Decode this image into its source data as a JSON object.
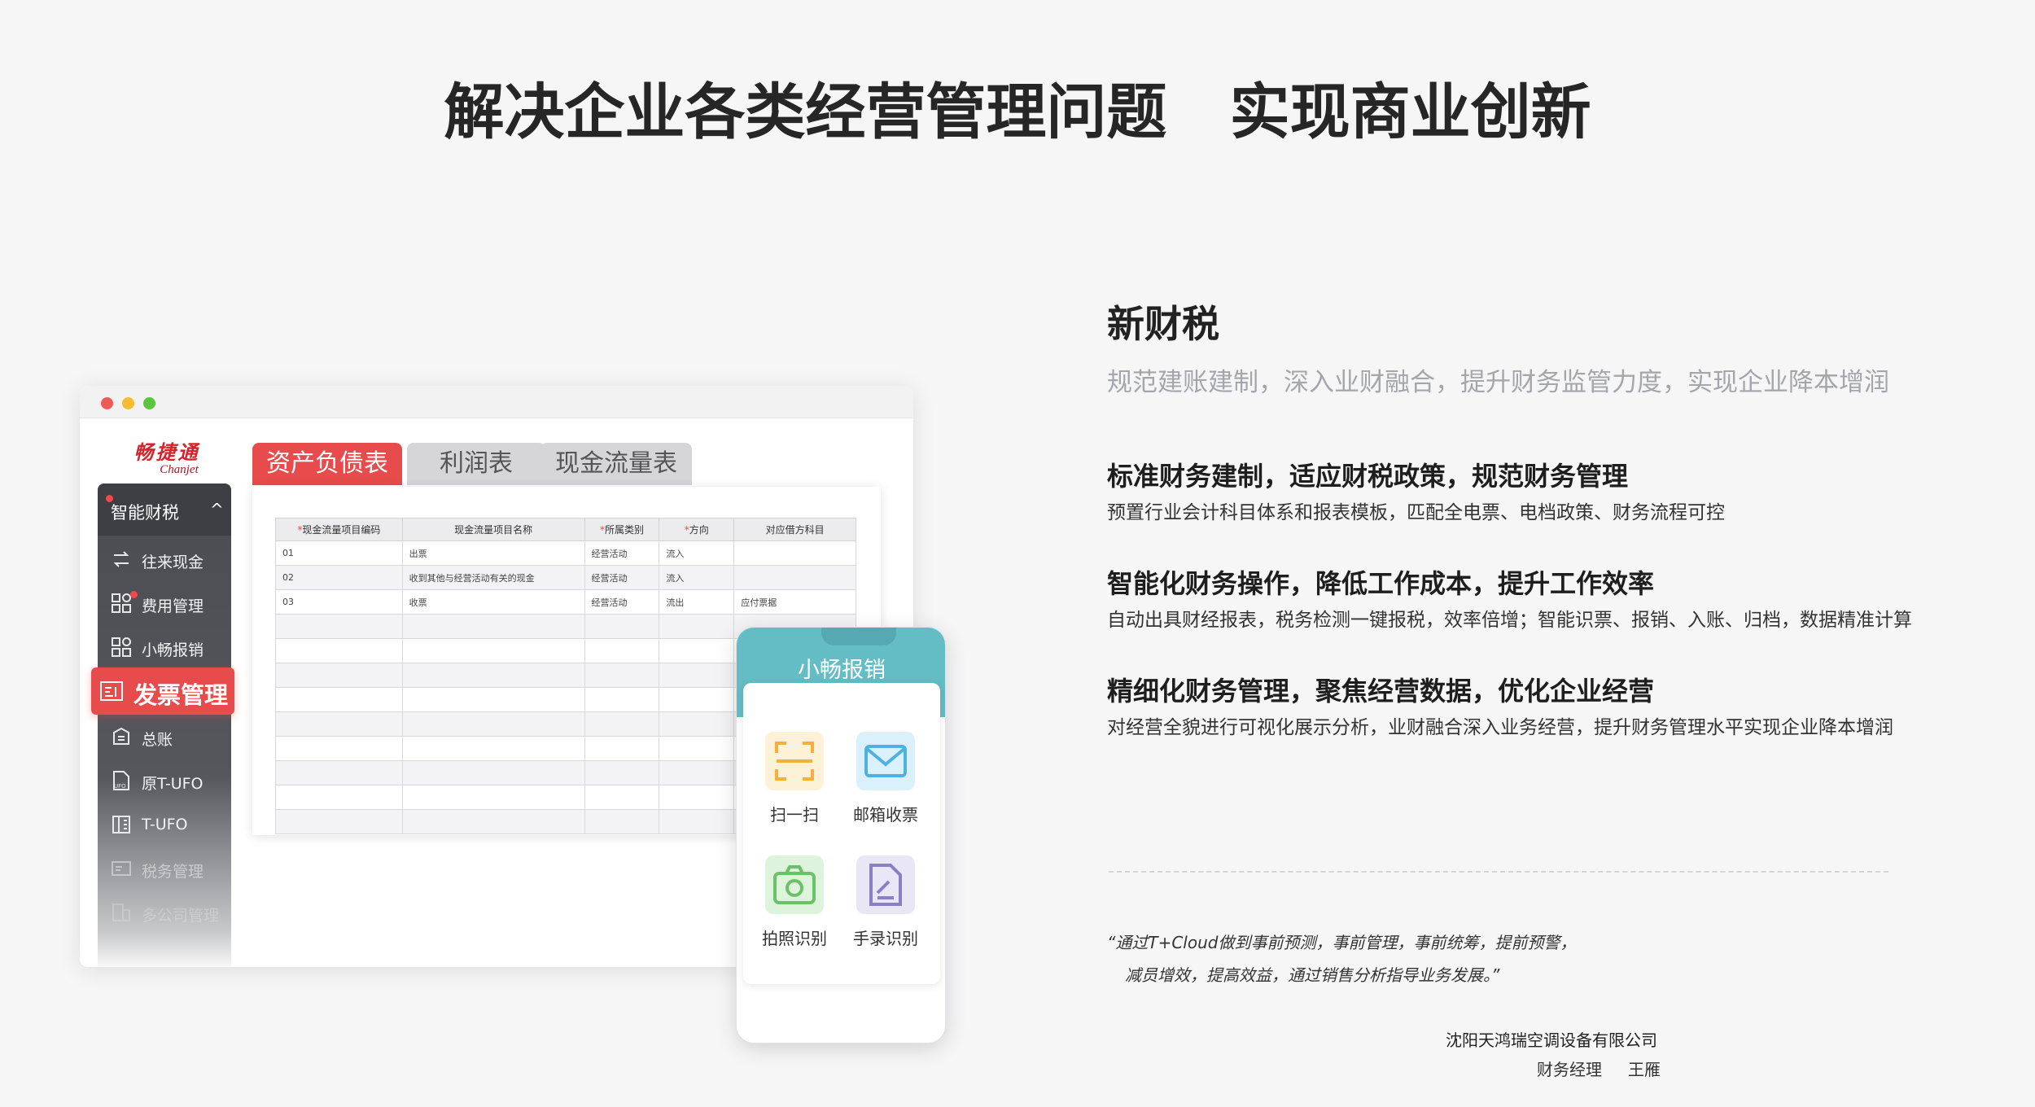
{
  "headline": "解决企业各类经营管理问题   实现商业创新",
  "app": {
    "logo_cn": "畅捷通",
    "logo_en": "Chanjet",
    "sidebar": {
      "section_label": "智能财税",
      "items": [
        {
          "label": "往来现金",
          "icon": "transfer-icon"
        },
        {
          "label": "费用管理",
          "icon": "grid-apps-icon"
        },
        {
          "label": "小畅报销",
          "icon": "grid-apps-icon"
        },
        {
          "label": "发票管理",
          "icon": "invoice-icon",
          "active": true
        },
        {
          "label": "总账",
          "icon": "ledger-icon"
        },
        {
          "label": "原T-UFO",
          "icon": "ufo-file-icon"
        },
        {
          "label": "T-UFO",
          "icon": "building-icon"
        },
        {
          "label": "税务管理",
          "icon": "tax-card-icon"
        },
        {
          "label": "多公司管理",
          "icon": "companies-icon"
        }
      ]
    },
    "tabs": [
      "资产负债表",
      "利润表",
      "现金流量表"
    ],
    "table": {
      "headers": [
        "现金流量项目编码",
        "现金流量项目名称",
        "所属类别",
        "方向",
        "对应借方科目"
      ],
      "required": [
        true,
        false,
        true,
        true,
        false
      ],
      "rows": [
        [
          "01",
          "出票",
          "经营活动",
          "流入",
          ""
        ],
        [
          "02",
          "收到其他与经营活动有关的现金",
          "经营活动",
          "流入",
          ""
        ],
        [
          "03",
          "收票",
          "经营活动",
          "流出",
          "应付票据"
        ],
        [
          "",
          "",
          "",
          "",
          ""
        ],
        [
          "",
          "",
          "",
          "",
          ""
        ],
        [
          "",
          "",
          "",
          "",
          ""
        ],
        [
          "",
          "",
          "",
          "",
          ""
        ],
        [
          "",
          "",
          "",
          "",
          ""
        ],
        [
          "",
          "",
          "",
          "",
          ""
        ],
        [
          "",
          "",
          "",
          "",
          ""
        ],
        [
          "",
          "",
          "",
          "",
          ""
        ],
        [
          "",
          "",
          "",
          "",
          ""
        ]
      ]
    }
  },
  "mobile": {
    "title": "小畅报销",
    "features": [
      {
        "label": "扫一扫",
        "icon": "scan-icon",
        "color": "#f2b13b"
      },
      {
        "label": "邮箱收票",
        "icon": "mail-icon",
        "color": "#4fb1e0"
      },
      {
        "label": "拍照识别",
        "icon": "camera-icon",
        "color": "#6cc168"
      },
      {
        "label": "手录识别",
        "icon": "edit-doc-icon",
        "color": "#8b7fc6"
      }
    ]
  },
  "section": {
    "title": "新财税",
    "subtitle": "规范建账建制，深入业财融合，提升财务监管力度，实现企业降本增润",
    "features": [
      {
        "head": "标准财务建制，适应财税政策，规范财务管理",
        "desc": "预置行业会计科目体系和报表模板，匹配全电票、电档政策、财务流程可控"
      },
      {
        "head": "智能化财务操作，降低工作成本，提升工作效率",
        "desc": "自动出具财经报表，税务检测一键报税，效率倍增；智能识票、报销、入账、归档，数据精准计算"
      },
      {
        "head": "精细化财务管理，聚焦经营数据，优化企业经营",
        "desc": "对经营全貌进行可视化展示分析，业财融合深入业务经营，提升财务管理水平实现企业降本增润"
      }
    ]
  },
  "testimonial": {
    "quote_line1": "“通过T+Cloud做到事前预测，事前管理，事前统筹，提前预警，",
    "quote_line2": "减员增效，提高效益，通过销售分析指导业务发展。”",
    "company": "沈阳天鸿瑞空调设备有限公司",
    "role": "财务经理",
    "person": "王雁"
  },
  "colors": {
    "accent_red": "#e84b4b",
    "phone_teal": "#64bcc5",
    "sidebar_dark": "#4a4c52",
    "muted_gray": "#a4a6ab"
  }
}
